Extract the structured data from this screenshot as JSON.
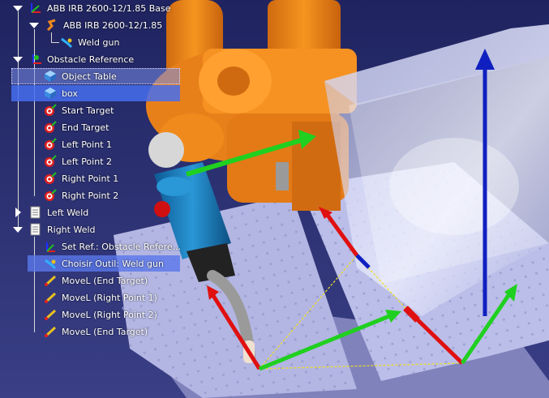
{
  "tree": {
    "items": [
      {
        "label": "ABB IRB 2600-12/1.85 Base",
        "icon": "frame-axes-icon"
      },
      {
        "label": "ABB IRB 2600-12/1.85",
        "icon": "robot-arm-icon"
      },
      {
        "label": "Weld gun",
        "icon": "weld-gun-icon"
      },
      {
        "label": "Obstacle Reference",
        "icon": "frame-axes-icon"
      },
      {
        "label": "Object Table",
        "icon": "cube-icon"
      },
      {
        "label": "box",
        "icon": "cube-icon"
      },
      {
        "label": "Start Target",
        "icon": "target-icon"
      },
      {
        "label": "End Target",
        "icon": "target-icon"
      },
      {
        "label": "Left Point 1",
        "icon": "target-icon"
      },
      {
        "label": "Left Point 2",
        "icon": "target-icon"
      },
      {
        "label": "Right Point 1",
        "icon": "target-icon"
      },
      {
        "label": "Right Point 2",
        "icon": "target-icon"
      },
      {
        "label": "Left Weld",
        "icon": "program-icon"
      },
      {
        "label": "Right Weld",
        "icon": "program-icon"
      },
      {
        "label": "Set Ref.: Obstacle Refere...",
        "icon": "set-reference-icon"
      },
      {
        "label": "Choisir Outil: Weld gun",
        "icon": "set-tool-icon"
      },
      {
        "label": "MoveL (End Target)",
        "icon": "move-linear-icon"
      },
      {
        "label": "MoveL (Right Point 1)",
        "icon": "move-linear-icon"
      },
      {
        "label": "MoveL (Right Point 2)",
        "icon": "move-linear-icon"
      },
      {
        "label": "MoveL (End Target)",
        "icon": "move-linear-icon"
      }
    ]
  },
  "colors": {
    "background": "#2a2d6e",
    "robot_orange": "#f08a1c",
    "weld_gun_blue": "#1d7fc0",
    "table_lavender": "#b8bce6",
    "axis_red": "#e01010",
    "axis_green": "#20d020",
    "axis_blue": "#1020c0",
    "path_yellow": "#f0e020",
    "selection_blue": "#4a78f0"
  }
}
